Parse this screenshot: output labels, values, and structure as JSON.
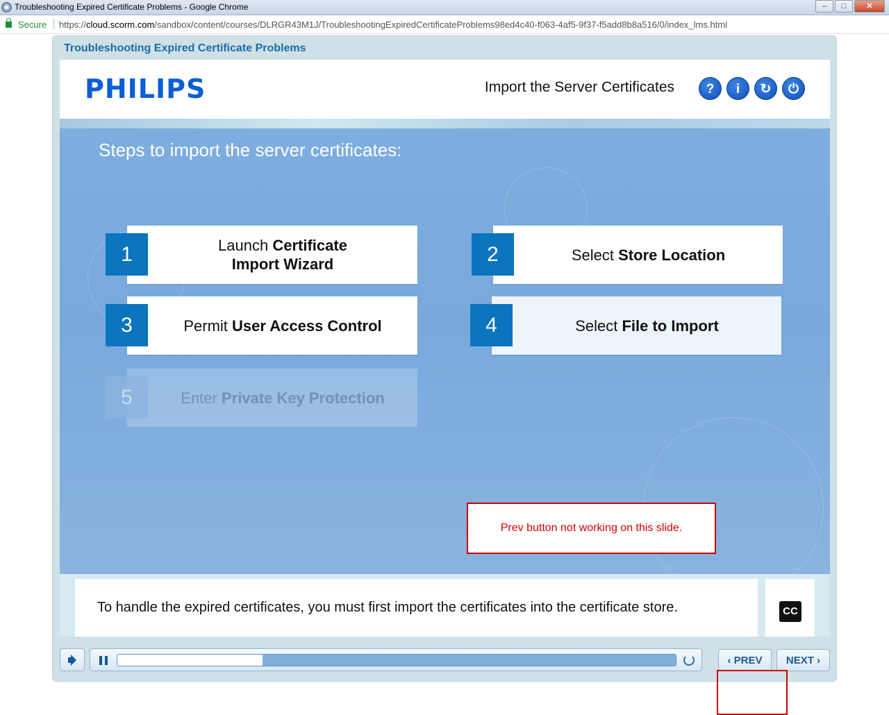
{
  "browser": {
    "window_title": "Troubleshooting Expired Certificate Problems - Google Chrome",
    "secure_label": "Secure",
    "url_scheme": "https://",
    "url_host": "cloud.scorm.com",
    "url_path": "/sandbox/content/courses/DLRGR43M1J/TroubleshootingExpiredCertificateProblems98ed4c40-f063-4af5-9f37-f5add8b8a516/0/index_lms.html",
    "buttons": {
      "minimize": "–",
      "maximize": "□",
      "close": "✕"
    }
  },
  "course": {
    "title": "Troubleshooting Expired Certificate Problems",
    "logo": "PHILIPS",
    "slide_title": "Import the Server Certificates",
    "header_buttons": [
      {
        "icon": "help-icon",
        "glyph": "?"
      },
      {
        "icon": "info-icon",
        "glyph": "i"
      },
      {
        "icon": "replay-icon",
        "glyph": "↻"
      },
      {
        "icon": "power-icon",
        "glyph": "⏻"
      }
    ]
  },
  "slide": {
    "heading": "Steps to import the server certificates:",
    "steps": [
      {
        "num": "1",
        "pre": "Launch ",
        "bold": "Certificate",
        "line2": "Import Wizard"
      },
      {
        "num": "2",
        "pre": "Select ",
        "bold": "Store Location"
      },
      {
        "num": "3",
        "pre": "Permit ",
        "bold": "User Access Control"
      },
      {
        "num": "4",
        "pre": "Select ",
        "bold": "File to Import"
      },
      {
        "num": "5",
        "pre": "Enter ",
        "bold": "Private Key Protection"
      }
    ],
    "note": "Prev button not working on this slide."
  },
  "caption": {
    "text": "To handle the expired certificates, you must first import the certificates into the certificate store.",
    "cc_label": "CC"
  },
  "controls": {
    "progress_fraction": 0.26,
    "prev_label": "PREV",
    "next_label": "NEXT",
    "prev_glyph": "‹",
    "next_glyph": "›"
  },
  "colors": {
    "accent_blue": "#0a74bf",
    "stage_blue": "#7eaddf",
    "note_red": "#cc0000"
  }
}
